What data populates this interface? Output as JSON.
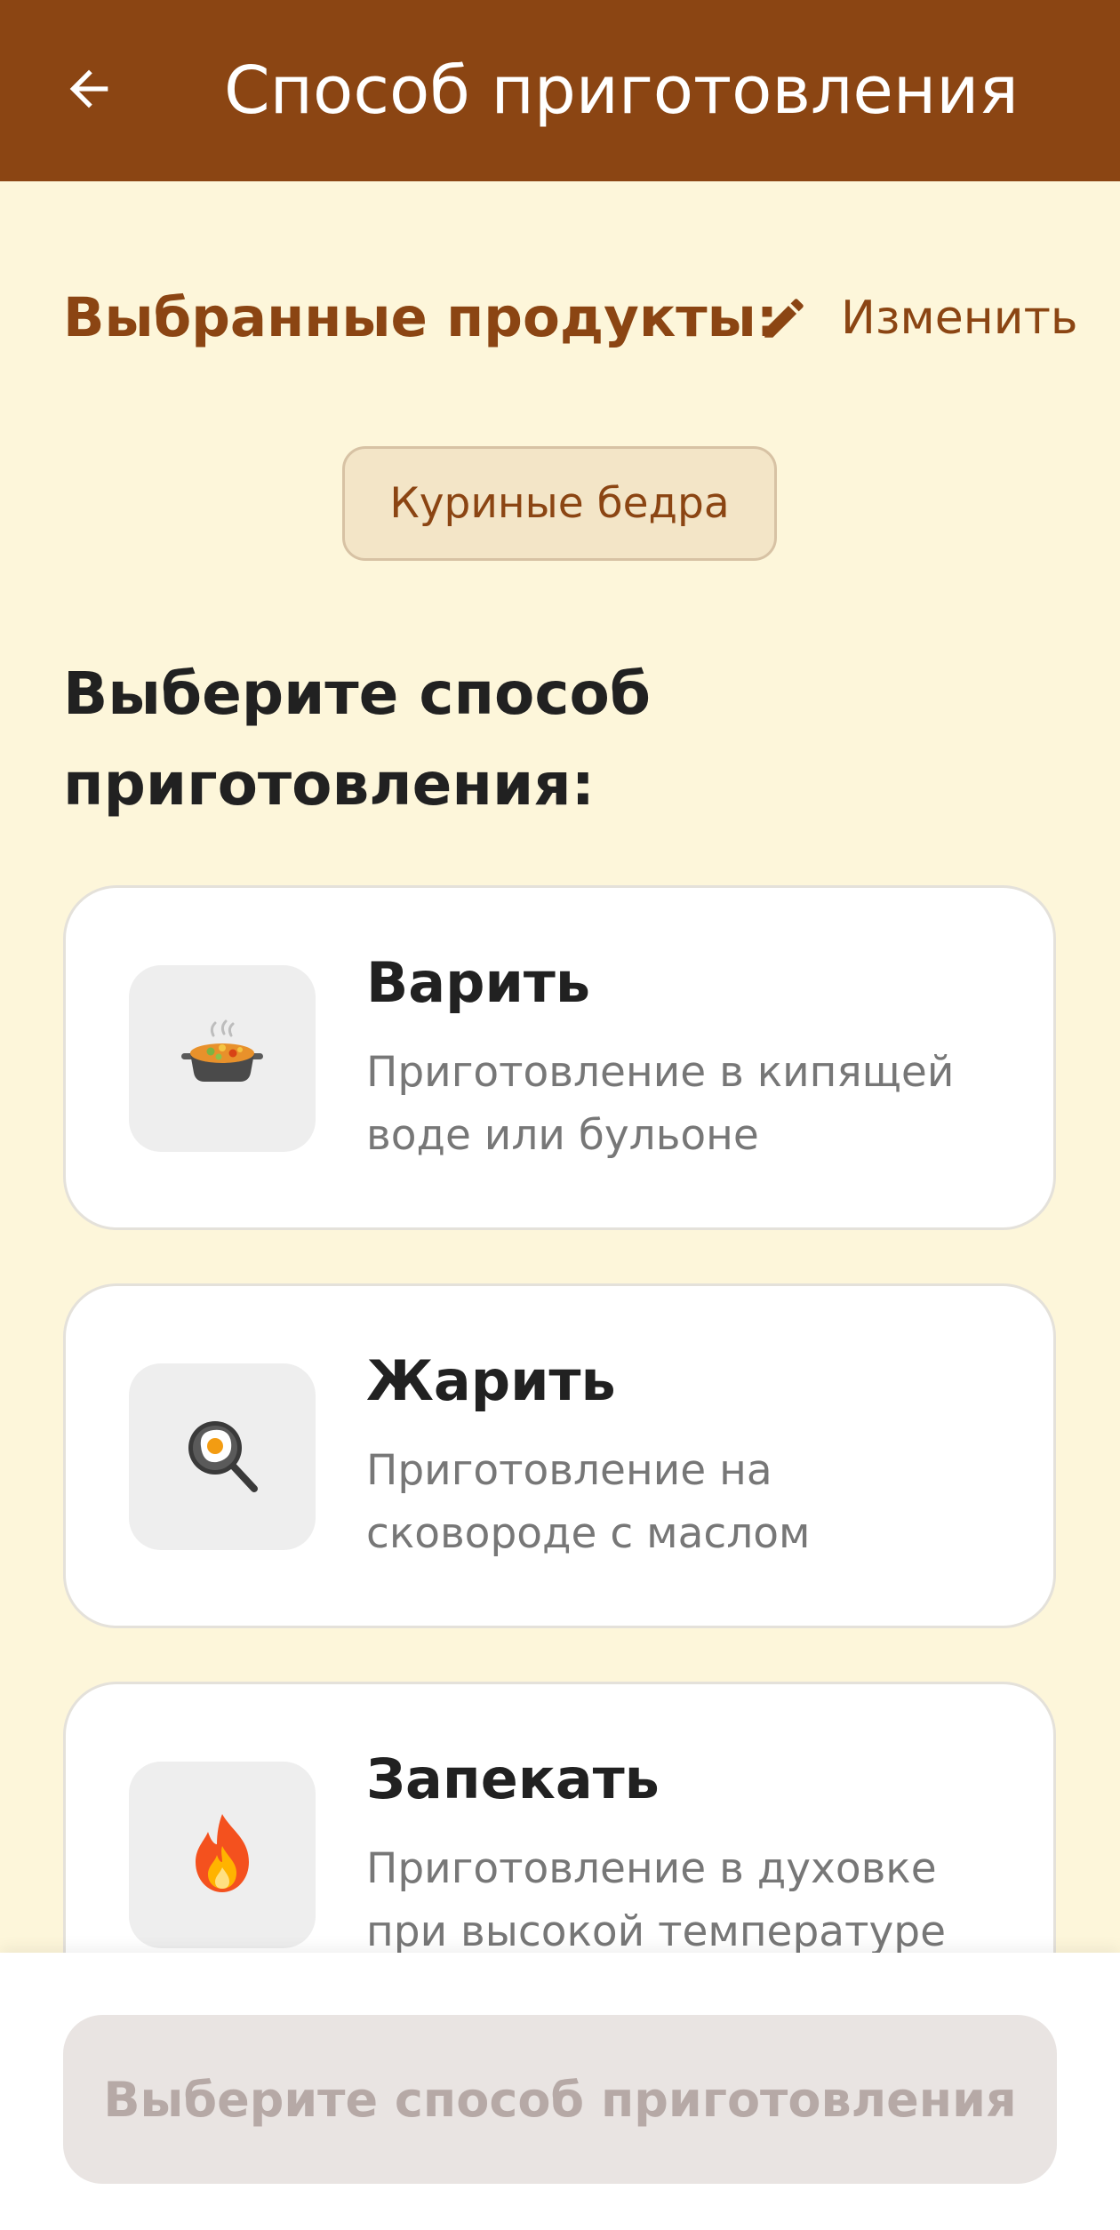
{
  "appbar": {
    "title": "Способ приготовления",
    "back_icon": "arrow-left-icon",
    "color": "#8B4513"
  },
  "selected": {
    "label": "Выбранные продукты:",
    "edit_label": "Изменить",
    "edit_icon": "pencil-icon",
    "products": [
      "Куриные бедра"
    ]
  },
  "methods_heading": "Выберите способ приготовления:",
  "methods": [
    {
      "title": "Варить",
      "description": "Приготовление в кипящей воде или бульоне",
      "icon": "pot-of-food-icon"
    },
    {
      "title": "Жарить",
      "description": "Приготовление на сковороде с маслом",
      "icon": "frying-pan-icon"
    },
    {
      "title": "Запекать",
      "description": "Приготовление в духовке при высокой температуре",
      "icon": "fire-icon"
    }
  ],
  "cta": {
    "label": "Выберите способ приготовления",
    "enabled": false
  },
  "colors": {
    "background": "#FDF6DA",
    "accent": "#8B4513",
    "chip_bg": "#F3E5C7",
    "disabled_button": "#E9E4E2"
  }
}
